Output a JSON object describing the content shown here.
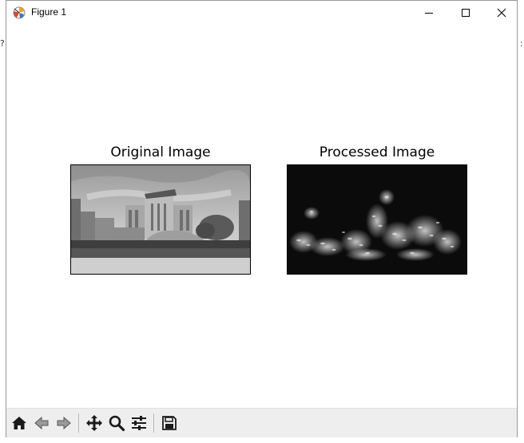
{
  "window": {
    "title": "Figure 1",
    "controls": {
      "minimize": "minimize",
      "maximize": "maximize",
      "close": "close"
    }
  },
  "figure": {
    "subplots": [
      {
        "title": "Original Image",
        "content": "grayscale photograph of a campus building"
      },
      {
        "title": "Processed Image",
        "content": "dark texture map with bright speckled regions"
      }
    ]
  },
  "toolbar": {
    "buttons": [
      {
        "icon": "home-icon",
        "tooltip": "Home"
      },
      {
        "icon": "back-arrow-icon",
        "tooltip": "Back"
      },
      {
        "icon": "forward-arrow-icon",
        "tooltip": "Forward"
      },
      {
        "icon": "pan-icon",
        "tooltip": "Pan"
      },
      {
        "icon": "zoom-icon",
        "tooltip": "Zoom"
      },
      {
        "icon": "configure-subplots-icon",
        "tooltip": "Configure subplots"
      },
      {
        "icon": "save-icon",
        "tooltip": "Save"
      }
    ]
  },
  "colors": {
    "titlebar": "#ffffff",
    "toolbar": "#eeeeee",
    "canvas": "#ffffff",
    "icon": "#1a1a1a"
  }
}
